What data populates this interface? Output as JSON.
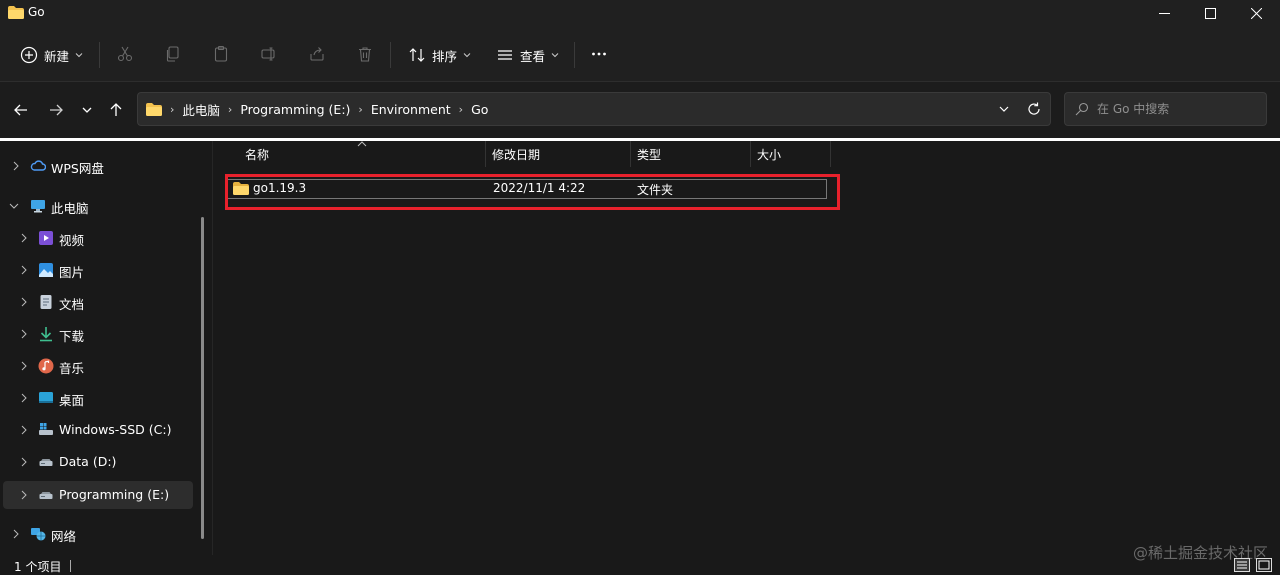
{
  "window": {
    "title": "Go"
  },
  "toolbar": {
    "new_label": "新建",
    "sort_label": "排序",
    "view_label": "查看"
  },
  "address": {
    "crumbs": [
      "此电脑",
      "Programming (E:)",
      "Environment",
      "Go"
    ]
  },
  "search": {
    "placeholder": "在 Go 中搜索"
  },
  "sidebar": {
    "items": [
      {
        "label": "WPS网盘",
        "icon": "cloud-icon"
      },
      {
        "label": "此电脑",
        "icon": "computer-icon"
      },
      {
        "label": "视频",
        "icon": "video-icon"
      },
      {
        "label": "图片",
        "icon": "pictures-icon"
      },
      {
        "label": "文档",
        "icon": "documents-icon"
      },
      {
        "label": "下载",
        "icon": "download-icon"
      },
      {
        "label": "音乐",
        "icon": "music-icon"
      },
      {
        "label": "桌面",
        "icon": "desktop-icon"
      },
      {
        "label": "Windows-SSD (C:)",
        "icon": "drive-c-icon"
      },
      {
        "label": "Data (D:)",
        "icon": "drive-icon"
      },
      {
        "label": "Programming (E:)",
        "icon": "drive-icon"
      },
      {
        "label": "网络",
        "icon": "network-icon"
      }
    ]
  },
  "columns": {
    "name": "名称",
    "modified": "修改日期",
    "type": "类型",
    "size": "大小"
  },
  "files": [
    {
      "name": "go1.19.3",
      "modified": "2022/11/1 4:22",
      "type": "文件夹",
      "size": ""
    }
  ],
  "status": {
    "count": "1 个项目"
  },
  "watermark": "@稀土掘金技术社区",
  "colors": {
    "highlight": "#e8212c",
    "folder": "#f3c24f",
    "background": "#191919"
  }
}
